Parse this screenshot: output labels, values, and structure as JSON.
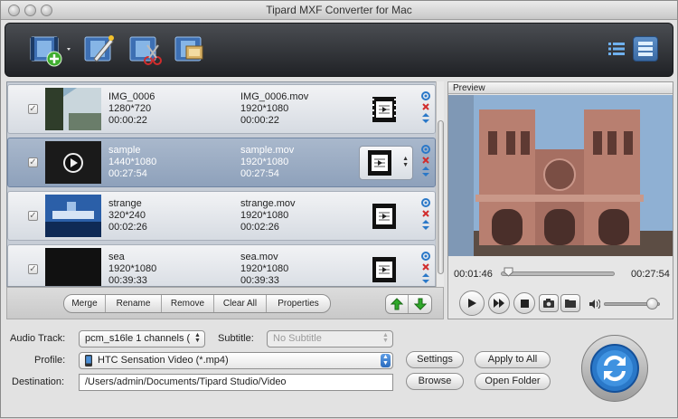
{
  "window": {
    "title": "Tipard MXF Converter for Mac"
  },
  "toolbar": {
    "icons": [
      "add-video-icon",
      "edit-icon",
      "clip-icon",
      "snapshot-merge-icon"
    ],
    "view_icons": [
      "list-view-icon",
      "grid-view-icon"
    ]
  },
  "files": [
    {
      "name": "IMG_0006",
      "res": "1280*720",
      "dur": "00:00:22",
      "out_name": "IMG_0006.mov",
      "out_res": "1920*1080",
      "out_dur": "00:00:22",
      "selected": false
    },
    {
      "name": "sample",
      "res": "1440*1080",
      "dur": "00:27:54",
      "out_name": "sample.mov",
      "out_res": "1920*1080",
      "out_dur": "00:27:54",
      "selected": true
    },
    {
      "name": "strange",
      "res": "320*240",
      "dur": "00:02:26",
      "out_name": "strange.mov",
      "out_res": "1920*1080",
      "out_dur": "00:02:26",
      "selected": false
    },
    {
      "name": "sea",
      "res": "1920*1080",
      "dur": "00:39:33",
      "out_name": "sea.mov",
      "out_res": "1920*1080",
      "out_dur": "00:39:33",
      "selected": false
    }
  ],
  "list_buttons": {
    "merge": "Merge",
    "rename": "Rename",
    "remove": "Remove",
    "clear_all": "Clear All",
    "properties": "Properties"
  },
  "preview": {
    "title": "Preview",
    "current": "00:01:46",
    "total": "00:27:54",
    "progress": 0.06,
    "volume": 0.85
  },
  "bottom": {
    "audio_label": "Audio Track:",
    "audio_value": "pcm_s16le 1 channels (",
    "subtitle_label": "Subtitle:",
    "subtitle_value": "No Subtitle",
    "profile_label": "Profile:",
    "profile_value": "HTC Sensation Video (*.mp4)",
    "destination_label": "Destination:",
    "destination_value": "/Users/admin/Documents/Tipard Studio/Video",
    "settings": "Settings",
    "apply_all": "Apply to All",
    "browse": "Browse",
    "open_folder": "Open Folder"
  },
  "colors": {
    "accent": "#2a78c8",
    "selected_row": "#9aabc3",
    "toolbar": "#2b2d31"
  }
}
